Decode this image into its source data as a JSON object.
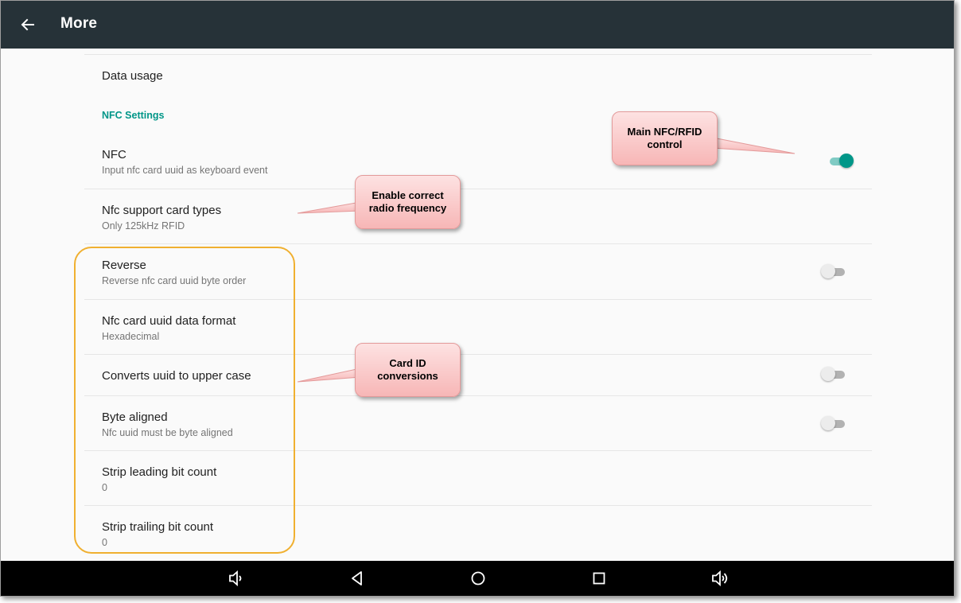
{
  "appbar": {
    "title": "More",
    "back_icon": "arrow-left-icon",
    "background_color": "#263238"
  },
  "settings": {
    "data_usage": {
      "title": "Data usage"
    },
    "nfc_section_header": "NFC Settings",
    "accent_color": "#009688",
    "nfc": {
      "title": "NFC",
      "subtitle": "Input nfc card uuid as keyboard event",
      "switch_on": true
    },
    "card_types": {
      "title": "Nfc support card types",
      "subtitle": "Only 125kHz RFID"
    },
    "reverse": {
      "title": "Reverse",
      "subtitle": "Reverse nfc card uuid byte order",
      "switch_on": false
    },
    "data_format": {
      "title": "Nfc card uuid data format",
      "subtitle": "Hexadecimal"
    },
    "upper_case": {
      "title": "Converts uuid to upper case",
      "switch_on": false
    },
    "byte_aligned": {
      "title": "Byte aligned",
      "subtitle": "Nfc uuid must be byte aligned",
      "switch_on": false
    },
    "strip_leading": {
      "title": "Strip leading bit count",
      "subtitle": "0"
    },
    "strip_trailing": {
      "title": "Strip trailing bit count",
      "subtitle": "0"
    }
  },
  "annotations": {
    "main_nfc": {
      "line1": "Main NFC/RFID",
      "line2": "control"
    },
    "radio_freq": {
      "line1": "Enable correct",
      "line2": "radio frequency"
    },
    "card_id": {
      "line1": "Card ID",
      "line2": "conversions"
    },
    "highlight_color": "#f0b030",
    "callout_color": "#f7b6b6"
  },
  "navbar": {
    "icons": [
      "volume-down-icon",
      "back-triangle-icon",
      "home-circle-icon",
      "recents-square-icon",
      "volume-up-icon"
    ]
  }
}
